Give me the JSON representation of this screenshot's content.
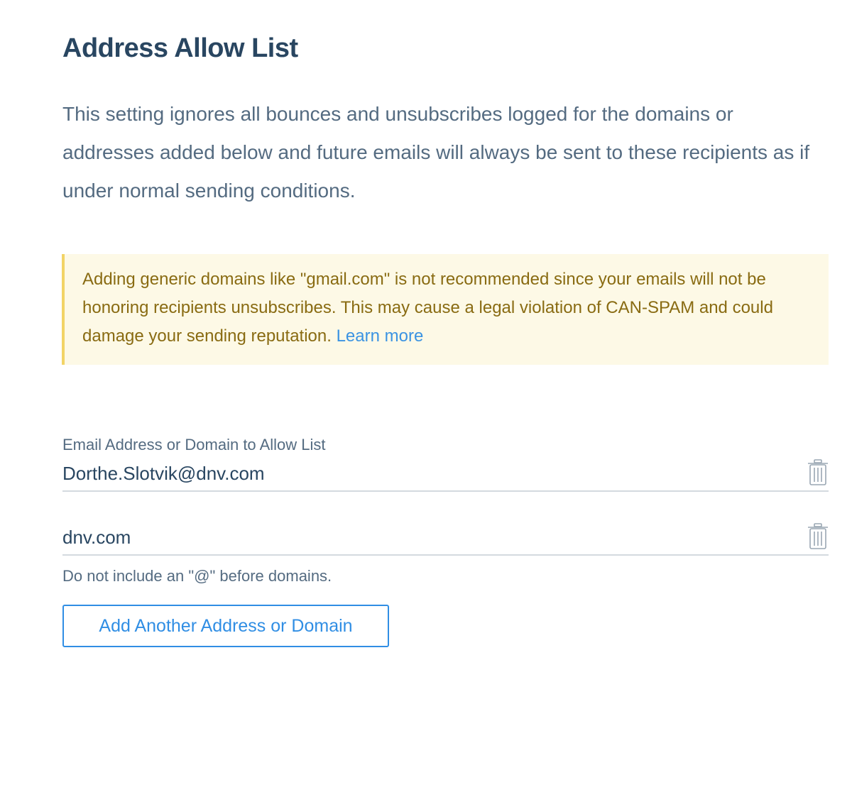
{
  "page": {
    "title": "Address Allow List",
    "description": "This setting ignores all bounces and unsubscribes logged for the domains or addresses added below and future emails will always be sent to these recipients as if under normal sending conditions."
  },
  "warning": {
    "text": "Adding generic domains like \"gmail.com\" is not recommended since your emails will not be honoring recipients unsubscribes. This may cause a legal violation of CAN-SPAM and could damage your sending reputation. ",
    "link_label": "Learn more"
  },
  "form": {
    "field_label": "Email Address or Domain to Allow List",
    "entries": [
      {
        "value": "Dorthe.Slotvik@dnv.com"
      },
      {
        "value": "dnv.com"
      }
    ],
    "helper_text": "Do not include an \"@\" before domains.",
    "add_button_label": "Add Another Address or Domain",
    "delete_icon": "trash-icon"
  },
  "colors": {
    "heading": "#294661",
    "body_text": "#546b81",
    "warning_bg": "#fdf9e6",
    "warning_border": "#f2d466",
    "warning_text": "#896b12",
    "link": "#1a82e2"
  }
}
